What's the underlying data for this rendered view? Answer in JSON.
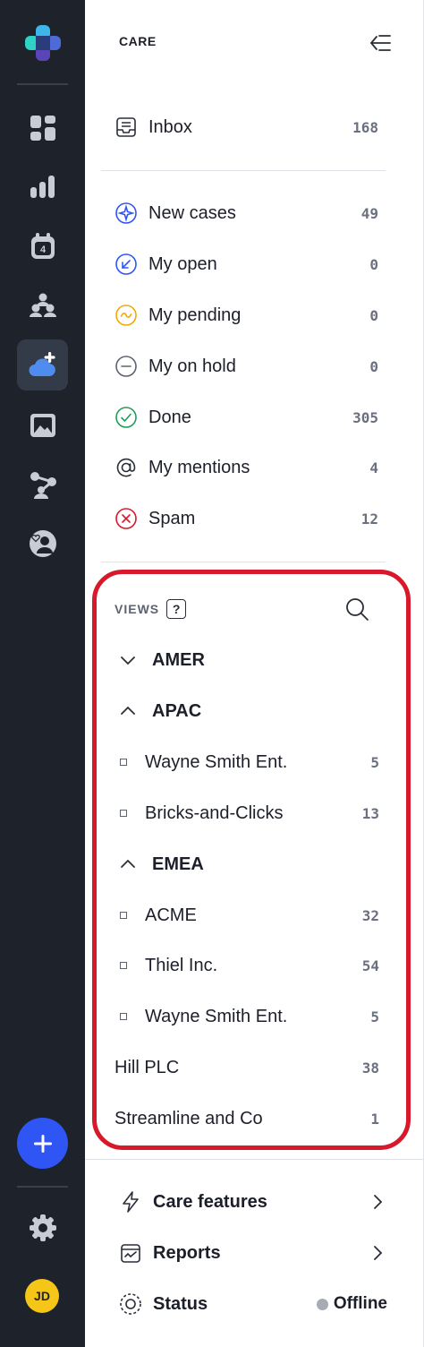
{
  "rail": {
    "icons": [
      "logo-icon",
      "dashboard-icon",
      "analytics-icon",
      "calendar-icon",
      "team-icon",
      "care-icon",
      "media-icon",
      "workflow-icon",
      "community-icon",
      "settings-icon"
    ],
    "active": "care-icon",
    "fab_icon": "plus-icon",
    "avatar_initials": "JD",
    "accent": "#2f56f5",
    "avatar_color": "#f5c518"
  },
  "panel": {
    "title": "CARE",
    "inbox": {
      "label": "Inbox",
      "count": "168"
    },
    "queues": [
      {
        "label": "New cases",
        "count": "49",
        "icon": "new-cases-icon"
      },
      {
        "label": "My open",
        "count": "0",
        "icon": "open-icon"
      },
      {
        "label": "My pending",
        "count": "0",
        "icon": "pending-icon"
      },
      {
        "label": "My on hold",
        "count": "0",
        "icon": "on-hold-icon"
      },
      {
        "label": "Done",
        "count": "305",
        "icon": "done-icon"
      },
      {
        "label": "My mentions",
        "count": "4",
        "icon": "mention-icon"
      },
      {
        "label": "Spam",
        "count": "12",
        "icon": "spam-icon"
      }
    ]
  },
  "views": {
    "title": "VIEWS",
    "help": "?",
    "groups": [
      {
        "label": "AMER",
        "expanded": false
      },
      {
        "label": "APAC",
        "expanded": true
      },
      {
        "label": "EMEA",
        "expanded": true
      }
    ],
    "apac_items": [
      {
        "label": "Wayne Smith Ent.",
        "count": "5"
      },
      {
        "label": "Bricks-and-Clicks",
        "count": "13"
      }
    ],
    "emea_items": [
      {
        "label": "ACME",
        "count": "32"
      },
      {
        "label": "Thiel Inc.",
        "count": "54"
      },
      {
        "label": "Wayne Smith Ent.",
        "count": "5"
      }
    ],
    "ungrouped": [
      {
        "label": "Hill PLC",
        "count": "38"
      },
      {
        "label": "Streamline and Co",
        "count": "1"
      }
    ],
    "highlight_color": "#d7192b"
  },
  "footer": {
    "care_features": "Care features",
    "reports": "Reports",
    "status_label": "Status",
    "status_value": "Offline"
  }
}
